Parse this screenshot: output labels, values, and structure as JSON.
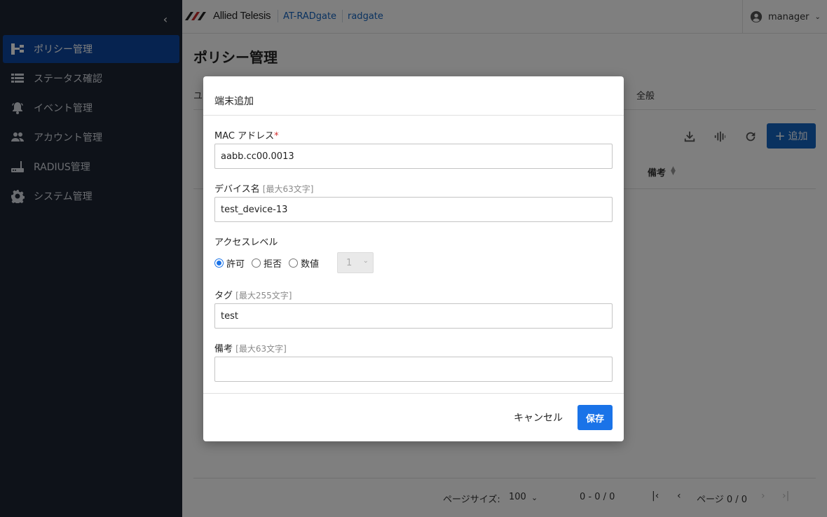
{
  "sidebar": {
    "items": [
      {
        "label": "ポリシー管理",
        "icon": "policy-tree-icon",
        "active": true
      },
      {
        "label": "ステータス確認",
        "icon": "list-icon",
        "active": false
      },
      {
        "label": "イベント管理",
        "icon": "bell-icon",
        "active": false
      },
      {
        "label": "アカウント管理",
        "icon": "people-icon",
        "active": false
      },
      {
        "label": "RADIUS管理",
        "icon": "router-icon",
        "active": false
      },
      {
        "label": "システム管理",
        "icon": "gear-icon",
        "active": false
      }
    ]
  },
  "header": {
    "logo_text": "Allied Telesis",
    "breadcrumb": [
      "AT-RADgate",
      "radgate"
    ],
    "user": "manager"
  },
  "page": {
    "title": "ポリシー管理",
    "tab_left": "ユ",
    "tab_right": "全般",
    "add_label": "追加",
    "column_note": "備考"
  },
  "pager": {
    "size_label": "ページサイズ:",
    "size_value": "100",
    "range": "0 - 0 / 0",
    "page_label": "ページ 0 / 0"
  },
  "modal": {
    "title": "端末追加",
    "mac": {
      "label": "MAC アドレス",
      "required": "*",
      "value": "aabb.cc00.0013"
    },
    "device": {
      "label": "デバイス名",
      "hint": "[最大63文字]",
      "value": "test_device-13"
    },
    "access": {
      "label": "アクセスレベル",
      "options": [
        "許可",
        "拒否",
        "数値"
      ],
      "selected": "許可",
      "numeric_value": "1"
    },
    "tag": {
      "label": "タグ",
      "hint": "[最大255文字]",
      "value": "test"
    },
    "note": {
      "label": "備考",
      "hint": "[最大63文字]",
      "value": ""
    },
    "cancel_label": "キャンセル",
    "save_label": "保存"
  },
  "colors": {
    "sidebar_bg": "#1c2433",
    "active_nav": "#0d47a1",
    "primary": "#1a73e8",
    "link": "#1565c0"
  }
}
